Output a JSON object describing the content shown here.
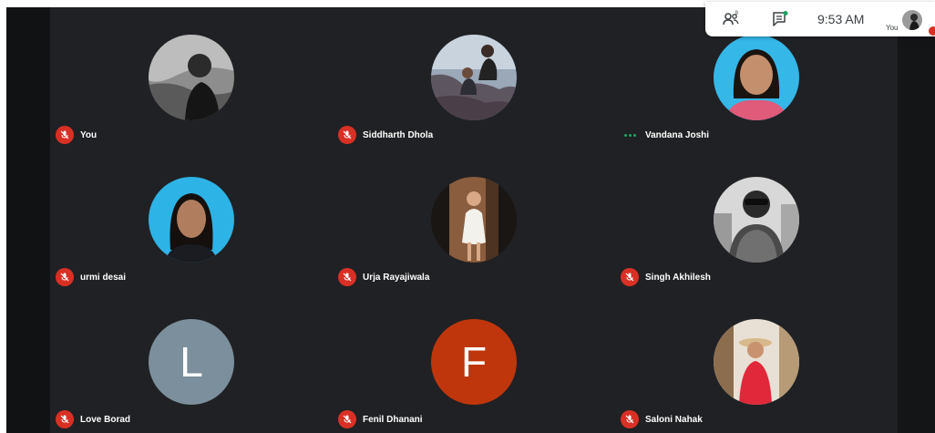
{
  "topbar": {
    "time": "9:53 AM",
    "self_label": "You",
    "participants_icon": "people-icon",
    "chat_icon": "chat-icon"
  },
  "colors": {
    "background": "#202124",
    "muted_badge": "#d93025",
    "speaking_dots": "#1ea362"
  },
  "participants": [
    {
      "name": "You",
      "avatar": "photo",
      "muted": true
    },
    {
      "name": "Siddharth Dhola",
      "avatar": "photo",
      "muted": true
    },
    {
      "name": "Vandana Joshi",
      "avatar": "photo",
      "muted": false,
      "status": "dots"
    },
    {
      "name": "urmi desai",
      "avatar": "photo",
      "muted": true
    },
    {
      "name": "Urja Rayajiwala",
      "avatar": "photo",
      "muted": true
    },
    {
      "name": "Singh Akhilesh",
      "avatar": "photo",
      "muted": true
    },
    {
      "name": "Love Borad",
      "avatar": "letter",
      "letter": "L",
      "muted": true,
      "avatar_color": "#7b8f9c"
    },
    {
      "name": "Fenil Dhanani",
      "avatar": "letter",
      "letter": "F",
      "muted": true,
      "avatar_color": "#bf360c"
    },
    {
      "name": "Saloni Nahak",
      "avatar": "photo",
      "muted": true
    }
  ]
}
